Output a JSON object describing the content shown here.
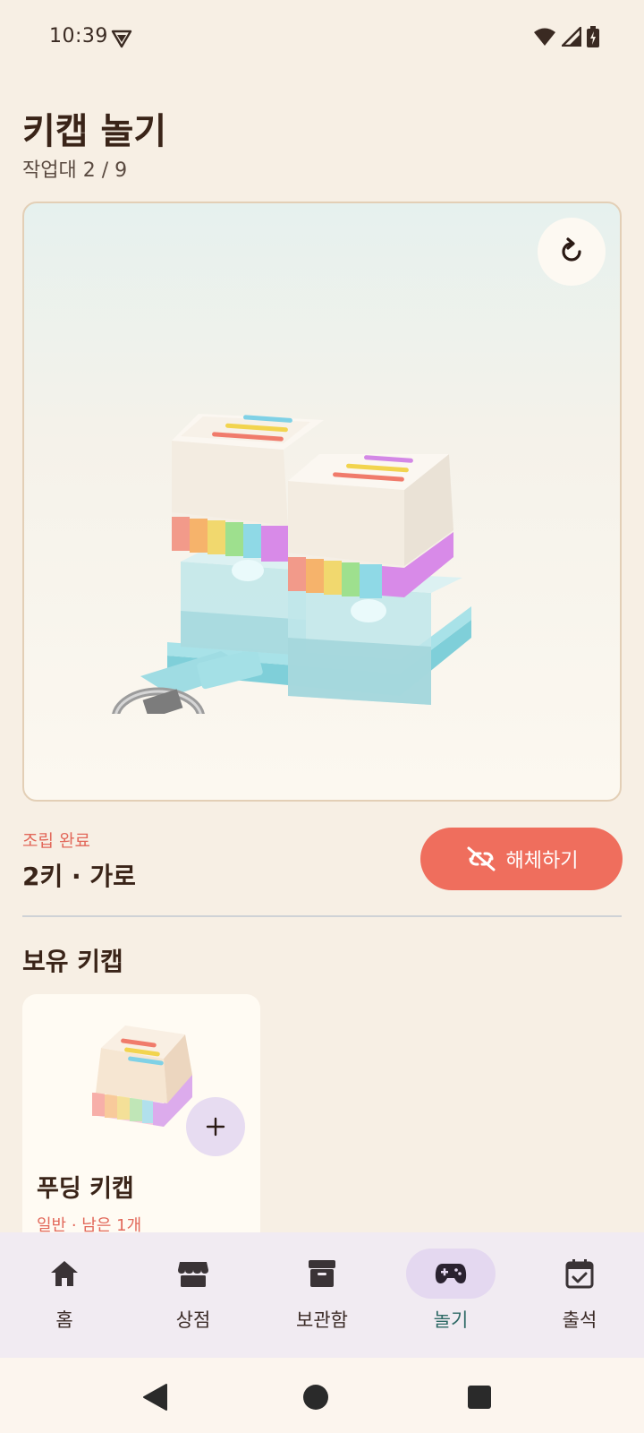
{
  "status": {
    "time": "10:39"
  },
  "header": {
    "title": "키캡 놀기",
    "subtitle": "작업대 2 / 9"
  },
  "assembly": {
    "status_label": "조립 완료",
    "info": "2키 · 가로",
    "disassemble_label": "해체하기"
  },
  "owned": {
    "section_title": "보유 키캡",
    "items": [
      {
        "name": "푸딩 키캡",
        "meta": "일반 · 남은 1개"
      }
    ]
  },
  "nav": {
    "items": [
      {
        "label": "홈",
        "icon": "home-icon",
        "active": false
      },
      {
        "label": "상점",
        "icon": "store-icon",
        "active": false
      },
      {
        "label": "보관함",
        "icon": "archive-icon",
        "active": false
      },
      {
        "label": "놀기",
        "icon": "gamepad-icon",
        "active": true
      },
      {
        "label": "출석",
        "icon": "calendar-check-icon",
        "active": false
      }
    ]
  },
  "colors": {
    "background": "#f7efe4",
    "accent": "#ef6e5d",
    "active_nav": "#2e6a66",
    "active_nav_bg": "#e4d8f0"
  }
}
